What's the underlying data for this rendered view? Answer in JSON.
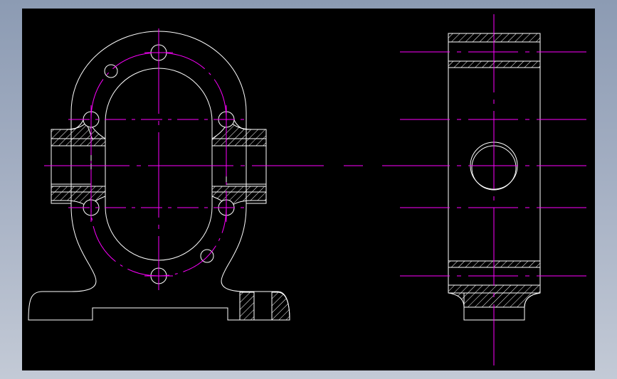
{
  "colors": {
    "frame": "#95a2b8",
    "background": "#000000",
    "outline": "#ffffff",
    "centerline": "#ff00ff"
  }
}
